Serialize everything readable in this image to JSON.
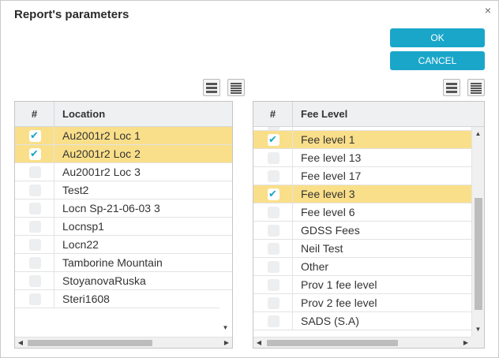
{
  "dialog": {
    "title": "Report's parameters",
    "close_glyph": "×",
    "ok_label": "OK",
    "cancel_label": "CANCEL"
  },
  "colors": {
    "accent": "#1aa6c9",
    "selected_row": "#fadf8a"
  },
  "icons": {
    "view_toggle_1": "list-view-icon",
    "view_toggle_2": "compact-list-icon"
  },
  "left_grid": {
    "hash_header": "#",
    "column_header": "Location",
    "rows": [
      {
        "label": "Au2001r2 Loc 1",
        "checked": true
      },
      {
        "label": "Au2001r2 Loc 2",
        "checked": true
      },
      {
        "label": "Au2001r2 Loc 3",
        "checked": false
      },
      {
        "label": "Test2",
        "checked": false
      },
      {
        "label": "Locn Sp-21-06-03 3",
        "checked": false
      },
      {
        "label": "Locnsp1",
        "checked": false
      },
      {
        "label": "Locn22",
        "checked": false
      },
      {
        "label": "Tamborine Mountain",
        "checked": false
      },
      {
        "label": "StoyanovaRuska",
        "checked": false
      },
      {
        "label": "Steri1608",
        "checked": false
      }
    ]
  },
  "right_grid": {
    "hash_header": "#",
    "column_header": "Fee Level",
    "rows": [
      {
        "label": "Fee level 1",
        "checked": true
      },
      {
        "label": "Fee level 13",
        "checked": false
      },
      {
        "label": "Fee level 17",
        "checked": false
      },
      {
        "label": "Fee level 3",
        "checked": true
      },
      {
        "label": "Fee level 6",
        "checked": false
      },
      {
        "label": "GDSS Fees",
        "checked": false
      },
      {
        "label": "Neil Test",
        "checked": false
      },
      {
        "label": "Other",
        "checked": false
      },
      {
        "label": "Prov 1 fee level",
        "checked": false
      },
      {
        "label": "Prov 2 fee level",
        "checked": false
      },
      {
        "label": "SADS (S.A)",
        "checked": false
      }
    ]
  }
}
